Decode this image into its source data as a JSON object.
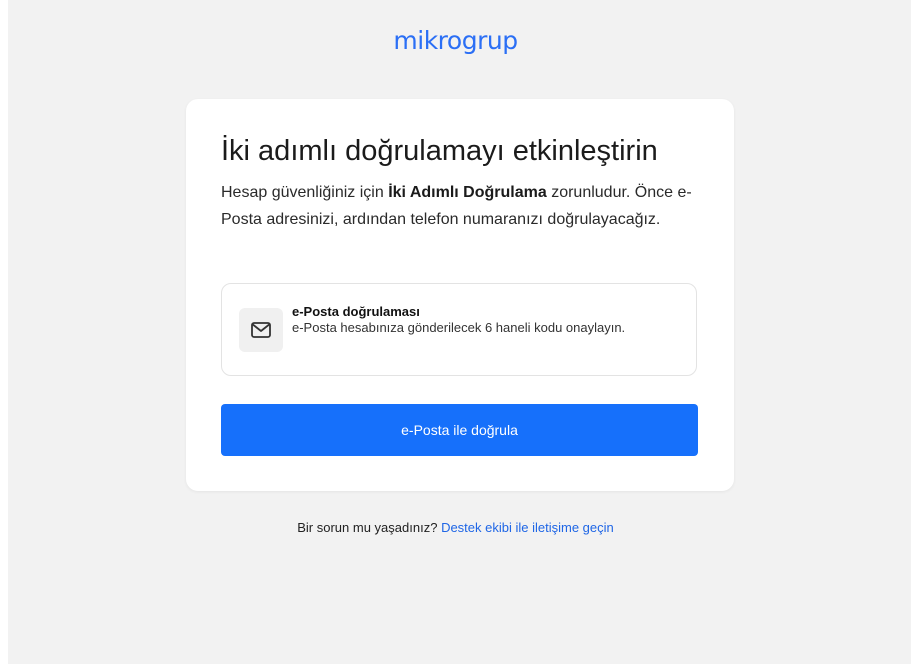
{
  "brand": {
    "logo_text": "mikrogrup",
    "accent_color": "#1670fb"
  },
  "card": {
    "title": "İki adımlı doğrulamayı etkinleştirin",
    "desc_part1": "Hesap güvenliğiniz için ",
    "desc_bold": "İki Adımlı Doğrulama",
    "desc_part2": " zorunludur. Önce e-Posta adresinizi, ardından telefon numaranızı doğrulayacağız."
  },
  "option": {
    "icon": "mail-icon",
    "title": "e-Posta doğrulaması",
    "description": "e-Posta hesabınıza gönderilecek 6 haneli kodu onaylayın."
  },
  "button": {
    "label": "e-Posta ile doğrula"
  },
  "footer": {
    "question": "Bir sorun mu yaşadınız?",
    "link_label": "Destek ekibi ile iletişime geçin"
  }
}
